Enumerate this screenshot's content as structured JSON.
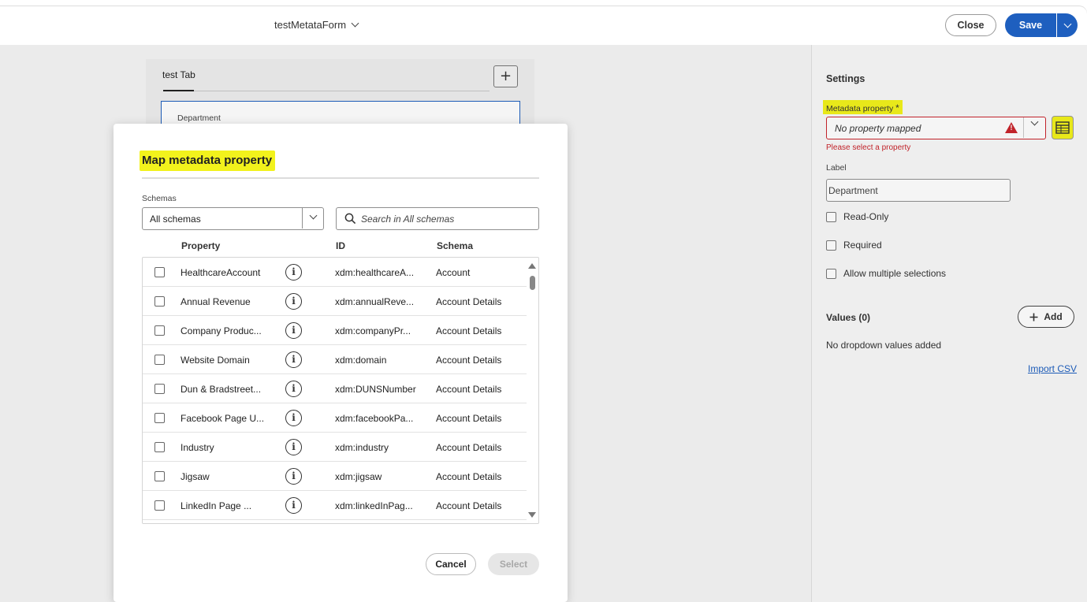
{
  "header": {
    "form_name": "testMetataForm",
    "close_label": "Close",
    "save_label": "Save"
  },
  "canvas": {
    "tab_label": "test Tab",
    "add_tab_symbol": "+",
    "field_label": "Department"
  },
  "settings": {
    "title": "Settings",
    "metadata_property_label": "Metadata property",
    "required_marker": "*",
    "metadata_property_placeholder": "No property mapped",
    "warning_symbol": "!",
    "error_text": "Please select a property",
    "label_label": "Label",
    "label_value": "Department",
    "checkboxes": [
      "Read-Only",
      "Required",
      "Allow multiple selections"
    ],
    "values_title": "Values (0)",
    "add_label": "Add",
    "no_values_text": "No dropdown values added",
    "import_csv_label": "Import CSV"
  },
  "modal": {
    "title": "Map metadata property",
    "schemas_label": "Schemas",
    "schema_value": "All schemas",
    "search_placeholder": "Search in All schemas",
    "columns": [
      "Property",
      "ID",
      "Schema"
    ],
    "info_symbol": "i",
    "rows": [
      {
        "property": "HealthcareAccount",
        "id": "xdm:healthcareA...",
        "schema": "Account"
      },
      {
        "property": "Annual Revenue",
        "id": "xdm:annualReve...",
        "schema": "Account Details"
      },
      {
        "property": "Company Produc...",
        "id": "xdm:companyPr...",
        "schema": "Account Details"
      },
      {
        "property": "Website Domain",
        "id": "xdm:domain",
        "schema": "Account Details"
      },
      {
        "property": "Dun & Bradstreet...",
        "id": "xdm:DUNSNumber",
        "schema": "Account Details"
      },
      {
        "property": "Facebook Page U...",
        "id": "xdm:facebookPa...",
        "schema": "Account Details"
      },
      {
        "property": "Industry",
        "id": "xdm:industry",
        "schema": "Account Details"
      },
      {
        "property": "Jigsaw",
        "id": "xdm:jigsaw",
        "schema": "Account Details"
      },
      {
        "property": "LinkedIn Page ...",
        "id": "xdm:linkedInPag...",
        "schema": "Account Details"
      }
    ],
    "cancel_label": "Cancel",
    "select_label": "Select"
  },
  "colors": {
    "accent": "#1e5fbf",
    "error": "#c9252c",
    "highlight": "#f2f21c"
  }
}
